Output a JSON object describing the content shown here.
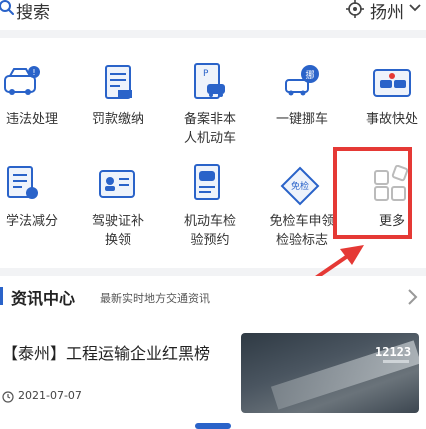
{
  "search": {
    "label": "搜索"
  },
  "location": {
    "city": "扬州"
  },
  "services": [
    {
      "label": "违法处理",
      "icon": "car-violation-icon"
    },
    {
      "label": "罚款缴纳",
      "icon": "fine-document-icon"
    },
    {
      "label": "备案非本\n人机动车",
      "icon": "vehicle-record-icon"
    },
    {
      "label": "一键挪车",
      "icon": "move-car-icon"
    },
    {
      "label": "事故快处",
      "icon": "accident-icon"
    },
    {
      "label": "学法减分",
      "icon": "study-checklist-icon"
    },
    {
      "label": "驾驶证补\n换领",
      "icon": "license-card-icon"
    },
    {
      "label": "机动车检\n验预约",
      "icon": "inspection-booking-icon"
    },
    {
      "label": "免检车申领\n检验标志",
      "icon": "exempt-badge-icon"
    },
    {
      "label": "更多",
      "icon": "more-grid-icon"
    }
  ],
  "news": {
    "title": "资讯中心",
    "subtitle": "最新实时地方交通资讯",
    "article": {
      "title": "【泰州】工程运输企业红黑榜",
      "date": "2021-07-07",
      "thumb_brand": "12123"
    }
  },
  "colors": {
    "accent": "#2a63c9",
    "highlight": "#e53935"
  }
}
